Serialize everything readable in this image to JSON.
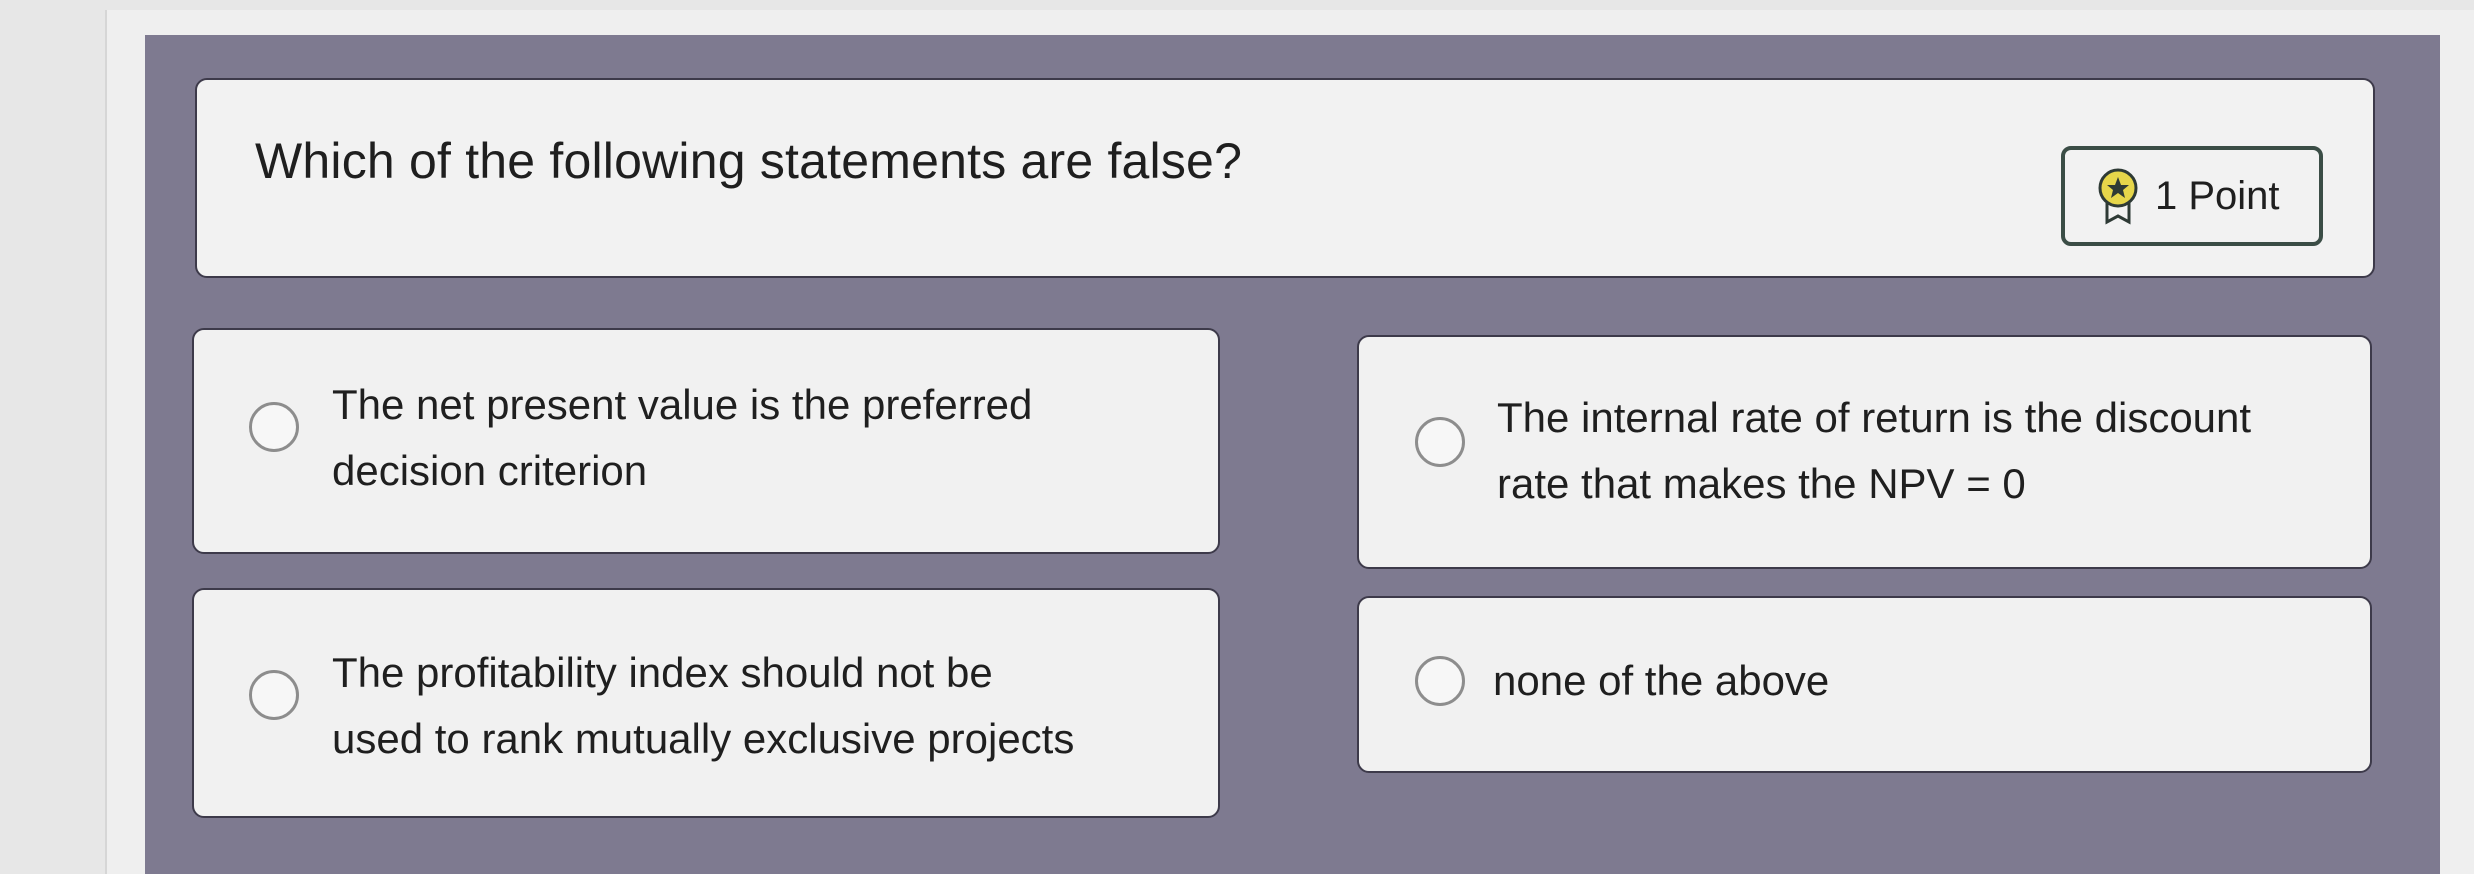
{
  "question": {
    "text": "Which of the following statements are false?",
    "points_label": "1 Point",
    "points_icon": "award-ribbon-icon"
  },
  "options": [
    {
      "label": "The net present value is the preferred\ndecision criterion",
      "selected": false
    },
    {
      "label": "The internal rate of return is the discount\nrate that makes the NPV = 0",
      "selected": false
    },
    {
      "label": "The profitability index should not be\nused to rank mutually exclusive projects",
      "selected": false
    },
    {
      "label": "none of the above",
      "selected": false
    }
  ],
  "colors": {
    "panel_background": "#7e7a90",
    "card_background": "#f2f2f2",
    "badge_border": "#3b4d46"
  }
}
